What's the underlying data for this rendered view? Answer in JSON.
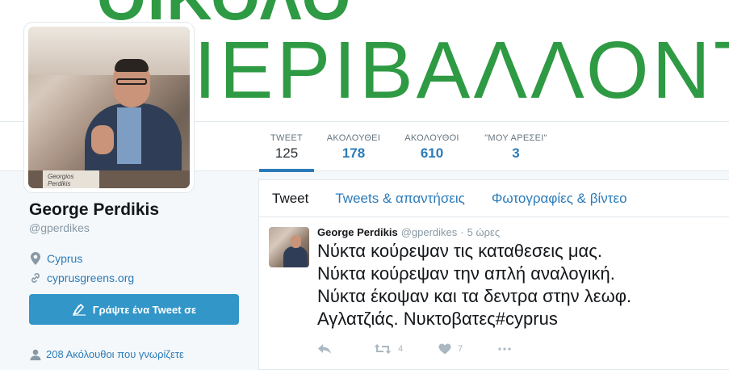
{
  "banner": {
    "top_text": "ΟΙΚΟΛΟ",
    "main_text": "ΙΕΡΙΒΑΛΛΟΝΤ"
  },
  "stats": [
    {
      "label": "TWEET",
      "value": "125"
    },
    {
      "label": "ΑΚΟΛΟΥΘΕΙ",
      "value": "178"
    },
    {
      "label": "ΑΚΟΛΟΥΘΟΙ",
      "value": "610"
    },
    {
      "label": "\"ΜΟΥ ΑΡΕΣΕΙ\"",
      "value": "3"
    }
  ],
  "profile": {
    "name": "George Perdikis",
    "handle": "@gperdikes",
    "location": "Cyprus",
    "website": "cyprusgreens.org",
    "tweet_to_label": "Γράψτε ένα Tweet σε",
    "followers_you_know": "208 Ακόλουθοι που γνωρίζετε",
    "avatar_nametag": "Georgios Perdikis"
  },
  "tabs": [
    {
      "label": "Tweet"
    },
    {
      "label": "Tweets & απαντήσεις"
    },
    {
      "label": "Φωτογραφίες & βίντεο"
    }
  ],
  "tweet": {
    "name": "George Perdikis",
    "handle": "@gperdikes",
    "separator": "·",
    "time": "5 ώρες",
    "lines": [
      "Νύκτα κούρεψαν τις καταθεσεις μας.",
      "Νύκτα κούρεψαν την απλή αναλογική.",
      "Νύκτα έκοψαν και τα δεντρα στην λεωφ.",
      "Αγλατζιάς. Νυκτοβατες#cyprus"
    ],
    "retweets": "4",
    "likes": "7"
  },
  "colors": {
    "accent": "#2b7bb9",
    "banner_green": "#2e9a43",
    "button_blue": "#3296c8"
  }
}
